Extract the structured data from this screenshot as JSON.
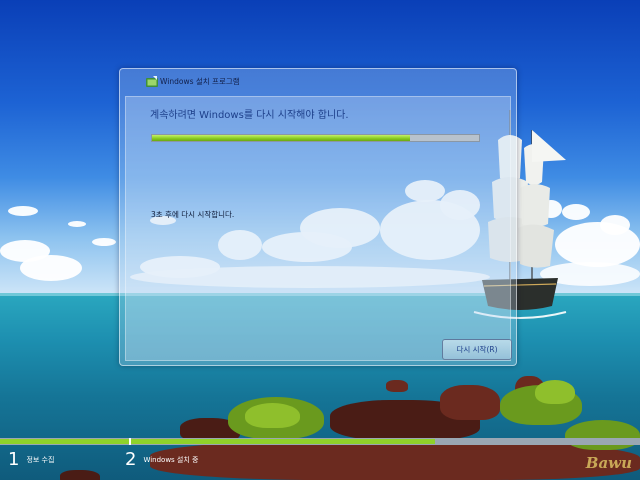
{
  "dialog": {
    "title": "Windows 설치 프로그램",
    "heading": "계속하려면 Windows를 다시 시작해야 합니다.",
    "countdown_text": "3초 후에 다시 시작합니다.",
    "progress_fraction": 0.79,
    "restart_button_label": "다시 시작(R)"
  },
  "steps": [
    {
      "number": "1",
      "label": "정보 수집"
    },
    {
      "number": "2",
      "label": "Windows 설치 중"
    }
  ],
  "step_progress_fraction": 0.68,
  "watermark": "Bawu",
  "colors": {
    "progress_green": "#8ccd22",
    "heading_blue": "#1d3f8a"
  }
}
